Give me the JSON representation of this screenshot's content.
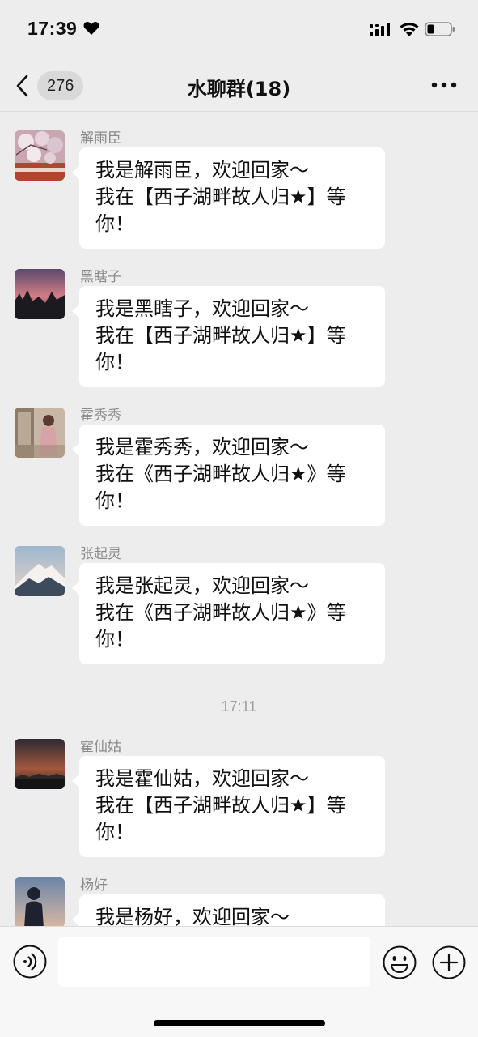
{
  "status_bar": {
    "time": "17:39",
    "icons": [
      "heart-icon",
      "signal-icon",
      "wifi-icon",
      "battery-icon"
    ]
  },
  "nav": {
    "unread_count": "276",
    "title": "水聊群(18)",
    "icons": [
      "back-chevron-icon",
      "more-icon"
    ]
  },
  "messages": [
    {
      "sender": "解雨臣",
      "lines": [
        "我是解雨臣，欢迎回家～",
        "我在【西子湖畔故人归★】等",
        "你！"
      ]
    },
    {
      "sender": "黑瞎子",
      "lines": [
        "我是黑瞎子，欢迎回家～",
        "我在【西子湖畔故人归★】等",
        "你！"
      ]
    },
    {
      "sender": "霍秀秀",
      "lines": [
        "我是霍秀秀，欢迎回家～",
        "我在《西子湖畔故人归★》等",
        "你！"
      ]
    },
    {
      "sender": "张起灵",
      "lines": [
        "我是张起灵，欢迎回家～",
        "我在《西子湖畔故人归★》等",
        "你！"
      ]
    },
    {
      "sender": "霍仙姑",
      "lines": [
        "我是霍仙姑，欢迎回家～",
        "我在【西子湖畔故人归★】等",
        "你！"
      ]
    },
    {
      "sender": "杨好",
      "lines": [
        "我是杨好，欢迎回家～"
      ]
    }
  ],
  "timestamp": "17:11",
  "input_bar": {
    "icons": [
      "voice-icon",
      "emoji-icon",
      "plus-icon"
    ]
  }
}
